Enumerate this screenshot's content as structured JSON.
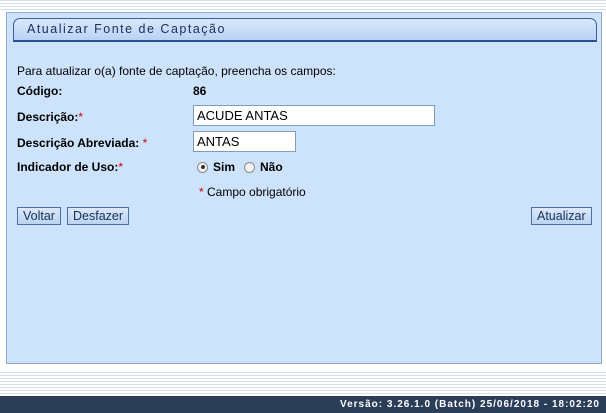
{
  "window": {
    "title": "Atualizar Fonte de Captação"
  },
  "form": {
    "intro": "Para atualizar o(a) fonte de captação, preencha os campos:",
    "codigo": {
      "label": "Código:",
      "value": "86"
    },
    "descricao": {
      "label": "Descrição:",
      "required_mark": "*",
      "value": "ACUDE ANTAS"
    },
    "descricao_abreviada": {
      "label": "Descrição Abreviada:",
      "required_mark": "*",
      "value": "ANTAS"
    },
    "indicador_uso": {
      "label": "Indicador de Uso:",
      "required_mark": "*",
      "options": [
        {
          "label": "Sim",
          "checked": true
        },
        {
          "label": "Não",
          "checked": false
        }
      ]
    },
    "required_note": {
      "mark": "*",
      "text": " Campo obrigatório"
    }
  },
  "buttons": {
    "voltar": "Voltar",
    "desfazer": "Desfazer",
    "atualizar": "Atualizar"
  },
  "footer": {
    "version": "Versão: 3.26.1.0 (Batch) 25/06/2018 - 18:02:20"
  },
  "colors": {
    "panel_bg": "#cde3fb",
    "footer_bg": "#2b3e58",
    "required": "#d40000"
  }
}
